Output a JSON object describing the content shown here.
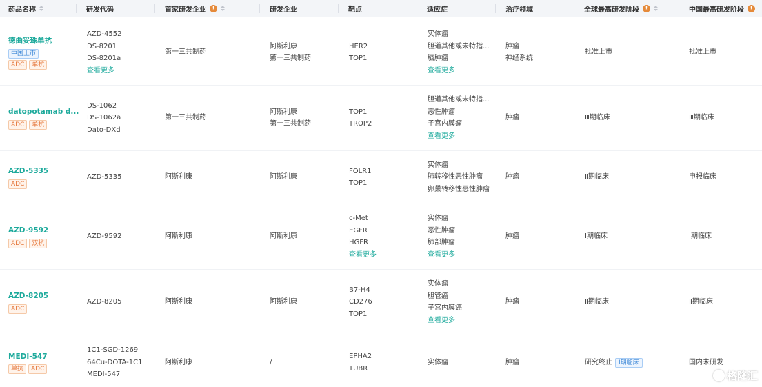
{
  "headers": {
    "drug_name": "药品名称",
    "rd_code": "研发代码",
    "first_company": "首家研发企业",
    "company": "研发企业",
    "target": "靶点",
    "indication": "适应症",
    "therapy_area": "治疗领域",
    "global_stage": "全球最高研发阶段",
    "china_stage": "中国最高研发阶段"
  },
  "info_icon_glyph": "!",
  "see_more_label": "查看更多",
  "rows": [
    {
      "name": "德曲妥珠单抗",
      "tags": [
        {
          "text": "中国上市",
          "style": "blue"
        }
      ],
      "tags2": [
        {
          "text": "ADC",
          "style": "orange"
        },
        {
          "text": "单抗",
          "style": "orange"
        }
      ],
      "codes": [
        "AZD-4552",
        "DS-8201",
        "DS-8201a"
      ],
      "codes_more": "查看更多",
      "first_company": "第一三共制药",
      "companies": [
        "阿斯利康",
        "第一三共制药"
      ],
      "targets": [
        "HER2",
        "TOP1"
      ],
      "targets_more": "",
      "indications": [
        "实体瘤",
        "胆道其他或未特指...",
        "脑肿瘤"
      ],
      "indications_more": "查看更多",
      "areas": [
        "肿瘤",
        "神经系统"
      ],
      "global_stage": "批准上市",
      "global_stage_tag": "",
      "china_stage": "批准上市"
    },
    {
      "name": "datopotamab d...",
      "tags": [],
      "tags2": [
        {
          "text": "ADC",
          "style": "orange"
        },
        {
          "text": "单抗",
          "style": "orange"
        }
      ],
      "codes": [
        "DS-1062",
        "DS-1062a",
        "Dato-DXd"
      ],
      "codes_more": "",
      "first_company": "第一三共制药",
      "companies": [
        "阿斯利康",
        "第一三共制药"
      ],
      "targets": [
        "TOP1",
        "TROP2"
      ],
      "targets_more": "",
      "indications": [
        "胆道其他或未特指...",
        "恶性肿瘤",
        "子宫内膜瘤"
      ],
      "indications_more": "查看更多",
      "areas": [
        "肿瘤"
      ],
      "global_stage": "Ⅲ期临床",
      "global_stage_tag": "",
      "china_stage": "Ⅲ期临床"
    },
    {
      "name": "AZD-5335",
      "tags": [],
      "tags2": [
        {
          "text": "ADC",
          "style": "orange"
        }
      ],
      "codes": [
        "AZD-5335"
      ],
      "codes_more": "",
      "first_company": "阿斯利康",
      "companies": [
        "阿斯利康"
      ],
      "targets": [
        "FOLR1",
        "TOP1"
      ],
      "targets_more": "",
      "indications": [
        "实体瘤",
        "肺转移性恶性肿瘤",
        "卵巢转移性恶性肿瘤"
      ],
      "indications_more": "",
      "areas": [
        "肿瘤"
      ],
      "global_stage": "Ⅱ期临床",
      "global_stage_tag": "",
      "china_stage": "申报临床"
    },
    {
      "name": "AZD-9592",
      "tags": [],
      "tags2": [
        {
          "text": "ADC",
          "style": "orange"
        },
        {
          "text": "双抗",
          "style": "orange"
        }
      ],
      "codes": [
        "AZD-9592"
      ],
      "codes_more": "",
      "first_company": "阿斯利康",
      "companies": [
        "阿斯利康"
      ],
      "targets": [
        "c-Met",
        "EGFR",
        "HGFR"
      ],
      "targets_more": "查看更多",
      "indications": [
        "实体瘤",
        "恶性肿瘤",
        "肺部肿瘤"
      ],
      "indications_more": "查看更多",
      "areas": [
        "肿瘤"
      ],
      "global_stage": "Ⅰ期临床",
      "global_stage_tag": "",
      "china_stage": "Ⅰ期临床"
    },
    {
      "name": "AZD-8205",
      "tags": [],
      "tags2": [
        {
          "text": "ADC",
          "style": "orange"
        }
      ],
      "codes": [
        "AZD-8205"
      ],
      "codes_more": "",
      "first_company": "阿斯利康",
      "companies": [
        "阿斯利康"
      ],
      "targets": [
        "B7-H4",
        "CD276",
        "TOP1"
      ],
      "targets_more": "",
      "indications": [
        "实体瘤",
        "胆管癌",
        "子宫内膜癌"
      ],
      "indications_more": "查看更多",
      "areas": [
        "肿瘤"
      ],
      "global_stage": "Ⅱ期临床",
      "global_stage_tag": "",
      "china_stage": "Ⅱ期临床"
    },
    {
      "name": "MEDI-547",
      "tags": [],
      "tags2": [
        {
          "text": "单抗",
          "style": "orange"
        },
        {
          "text": "ADC",
          "style": "orange"
        }
      ],
      "codes": [
        "1C1-SGD-1269",
        "64Cu-DOTA-1C1",
        "MEDI-547"
      ],
      "codes_more": "",
      "first_company": "阿斯利康",
      "companies": [
        "/"
      ],
      "targets": [
        "EPHA2",
        "TUBR"
      ],
      "targets_more": "",
      "indications": [
        "实体瘤"
      ],
      "indications_more": "",
      "areas": [
        "肿瘤"
      ],
      "global_stage": "研究终止",
      "global_stage_tag": "Ⅰ期临床",
      "china_stage": "国内未研发"
    }
  ],
  "watermark": "格隆汇",
  "colors": {
    "accent": "#1eaa9c",
    "tag_orange": "#e5763a",
    "tag_blue": "#3a86d6",
    "info_orange": "#e58a3a",
    "header_bg": "#f3f5f8"
  }
}
